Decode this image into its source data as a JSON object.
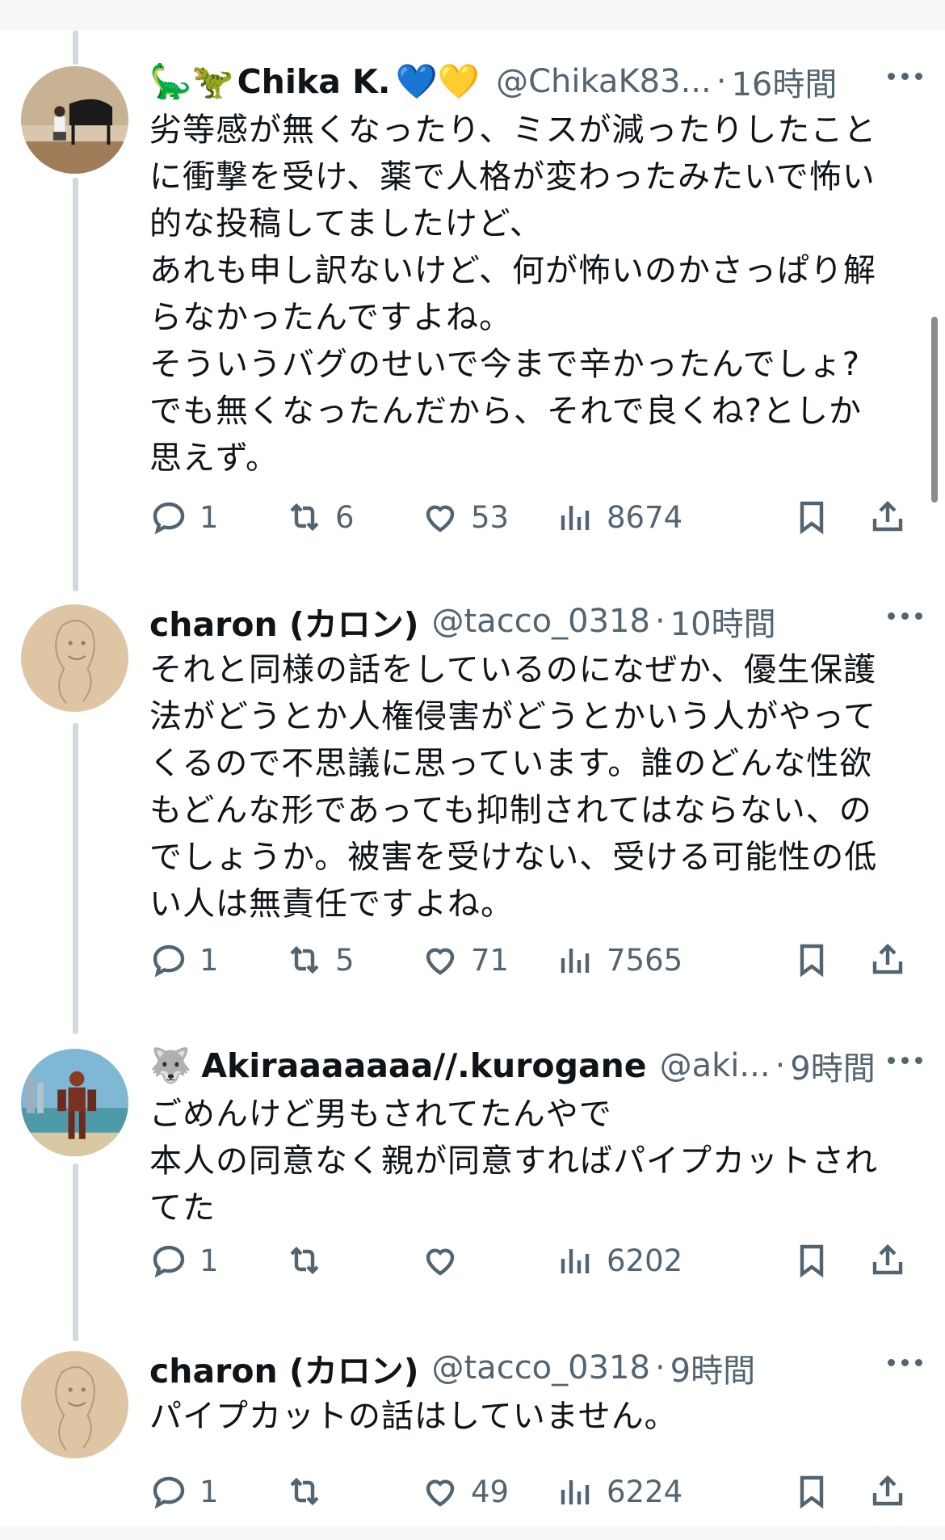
{
  "tweets": [
    {
      "display_name": "Chika K.",
      "name_emoji_before": "🦕🦖",
      "name_emoji_after": "💙💛",
      "handle": "@ChikaK83...",
      "time": "16時間",
      "body": "劣等感が無くなったり、ミスが減ったりしたこと\nに衝撃を受け、薬で人格が変わったみたいで怖い\n的な投稿してましたけど、\nあれも申し訳ないけど、何が怖いのかさっぱり解\nらなかったんですよね。\nそういうバグのせいで今まで辛かったんでしょ?\nでも無くなったんだから、それで良くね?としか\n思えず。",
      "replies": "1",
      "reposts": "6",
      "likes": "53",
      "views": "8674"
    },
    {
      "display_name": "charon (カロン)",
      "name_emoji_before": "",
      "name_emoji_after": "",
      "handle": "@tacco_0318",
      "time": "10時間",
      "body": "それと同様の話をしているのになぜか、優生保護\n法がどうとか人権侵害がどうとかいう人がやって\nくるので不思議に思っています。誰のどんな性欲\nもどんな形であっても抑制されてはならない、の\nでしょうか。被害を受けない、受ける可能性の低\nい人は無責任ですよね。",
      "replies": "1",
      "reposts": "5",
      "likes": "71",
      "views": "7565"
    },
    {
      "display_name": "Akiraaaaaaa//.kurogane",
      "name_emoji_before": "🐺",
      "name_emoji_after": "",
      "handle": "@aki...",
      "time": "9時間",
      "body": "ごめんけど男もされてたんやで\n本人の同意なく親が同意すればパイプカットされ\nてた",
      "replies": "1",
      "reposts": "",
      "likes": "",
      "views": "6202"
    },
    {
      "display_name": "charon (カロン)",
      "name_emoji_before": "",
      "name_emoji_after": "",
      "handle": "@tacco_0318",
      "time": "9時間",
      "body": "パイプカットの話はしていません。",
      "replies": "1",
      "reposts": "",
      "likes": "49",
      "views": "6224"
    }
  ],
  "separator": "·",
  "colors": {
    "text": "#0f1419",
    "secondary": "#536471",
    "thread_line": "#cfd9de",
    "background": "#ffffff"
  },
  "icons": [
    "reply-icon",
    "repost-icon",
    "like-icon",
    "views-icon",
    "bookmark-icon",
    "share-icon",
    "more-icon"
  ]
}
